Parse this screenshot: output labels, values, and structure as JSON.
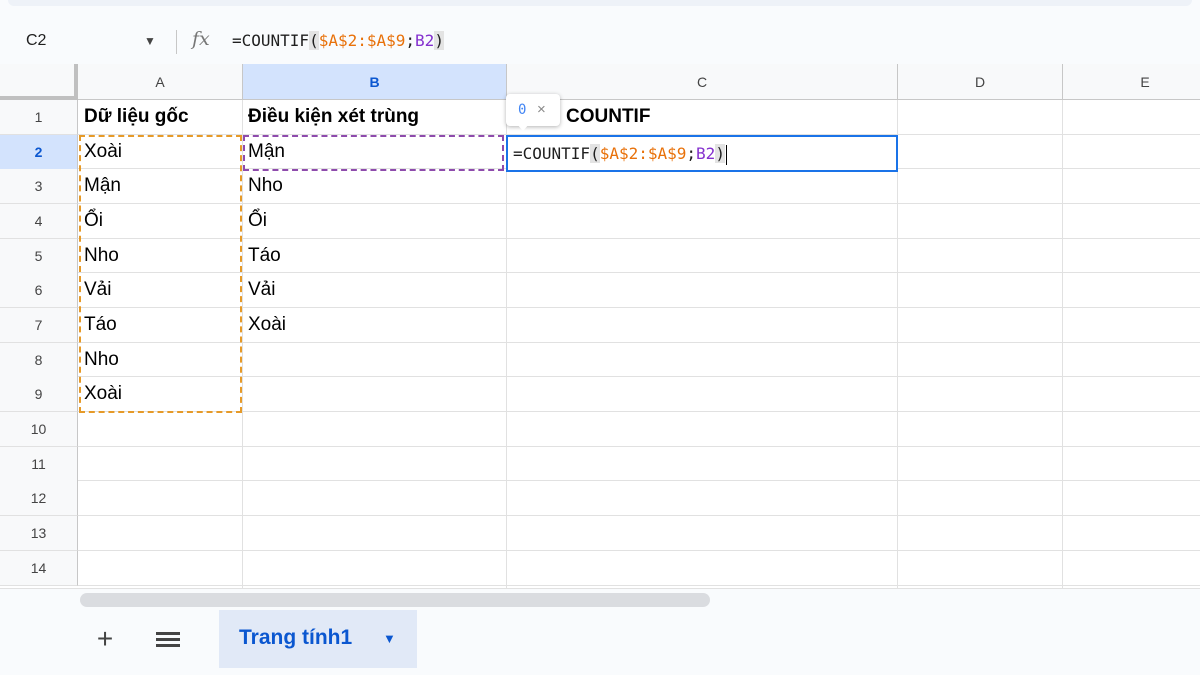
{
  "formula_bar": {
    "name_box": "C2",
    "fx_label": "fx",
    "formula_prefix": "=COUNTIF",
    "formula_open": "(",
    "formula_range": "$A$2:$A$9",
    "formula_sep": ";",
    "formula_ref": "B2",
    "formula_close": ")"
  },
  "columns": [
    "A",
    "B",
    "C",
    "D",
    "E"
  ],
  "rows": [
    "1",
    "2",
    "3",
    "4",
    "5",
    "6",
    "7",
    "8",
    "9",
    "10",
    "11",
    "12",
    "13",
    "14"
  ],
  "cells": {
    "A1": "Dữ liệu gốc",
    "B1": "Điều kiện xét trùng",
    "C1": "COUNTIF",
    "A": [
      "Xoài",
      "Mận",
      "Ổi",
      "Nho",
      "Vải",
      "Táo",
      "Nho",
      "Xoài"
    ],
    "B": [
      "Mận",
      "Nho",
      "Ổi",
      "Táo",
      "Vải",
      "Xoài"
    ]
  },
  "tooltip": {
    "value": "0",
    "close": "×"
  },
  "sheet_bar": {
    "add": "+",
    "sheet_name": "Trang tính1"
  },
  "colors": {
    "range_a": "#e69a28",
    "range_b": "#8e4bac",
    "active": "#1a73e8",
    "selected_header": "#d3e3fd"
  }
}
